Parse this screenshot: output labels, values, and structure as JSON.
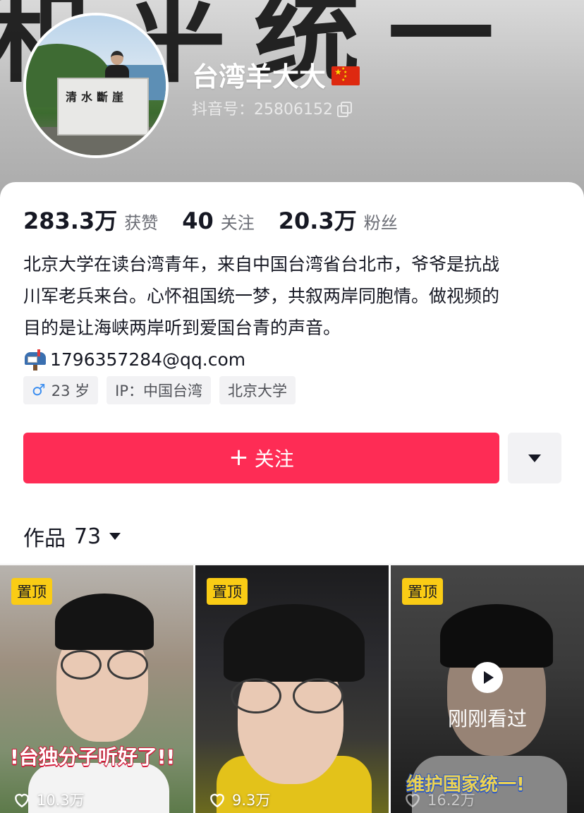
{
  "banner": {
    "calligraphy": "和平统一"
  },
  "profile": {
    "nickname": "台湾羊大大",
    "flag": "🇨🇳",
    "douyin_id": "抖音号：25806152"
  },
  "avatar": {
    "stone_text": "清水斷崖"
  },
  "stats": [
    {
      "value": "283.3万",
      "label": "获赞"
    },
    {
      "value": "40",
      "label": "关注"
    },
    {
      "value": "20.3万",
      "label": "粉丝"
    }
  ],
  "bio": {
    "lines": [
      "北京大学在读台湾青年，来自中国台湾省台北市，爷爷是抗战",
      "川军老兵来台。心怀祖国统一梦，共叙两岸同胞情。做视频的",
      "目的是让海峡两岸听到爱国台青的声音。"
    ],
    "email": "1796357284@qq.com"
  },
  "tags": {
    "gender_icon": "♂",
    "age": "23 岁",
    "ip": "IP：中国台湾",
    "school": "北京大学"
  },
  "actions": {
    "follow_plus": "+",
    "follow_label": "关注"
  },
  "works": {
    "label": "作品",
    "count": "73"
  },
  "videos": [
    {
      "pinned": "置顶",
      "likes": "10.3万",
      "caption": "!台独分子听好了!!"
    },
    {
      "pinned": "置顶",
      "likes": "9.3万"
    },
    {
      "pinned": "置顶",
      "likes": "16.2万",
      "caption": "维护国家统一!",
      "overlay": "刚刚看过"
    }
  ],
  "colors": {
    "accent": "#fe2c55",
    "pinned_badge": "#facc15",
    "male": "#3c8ef0"
  }
}
